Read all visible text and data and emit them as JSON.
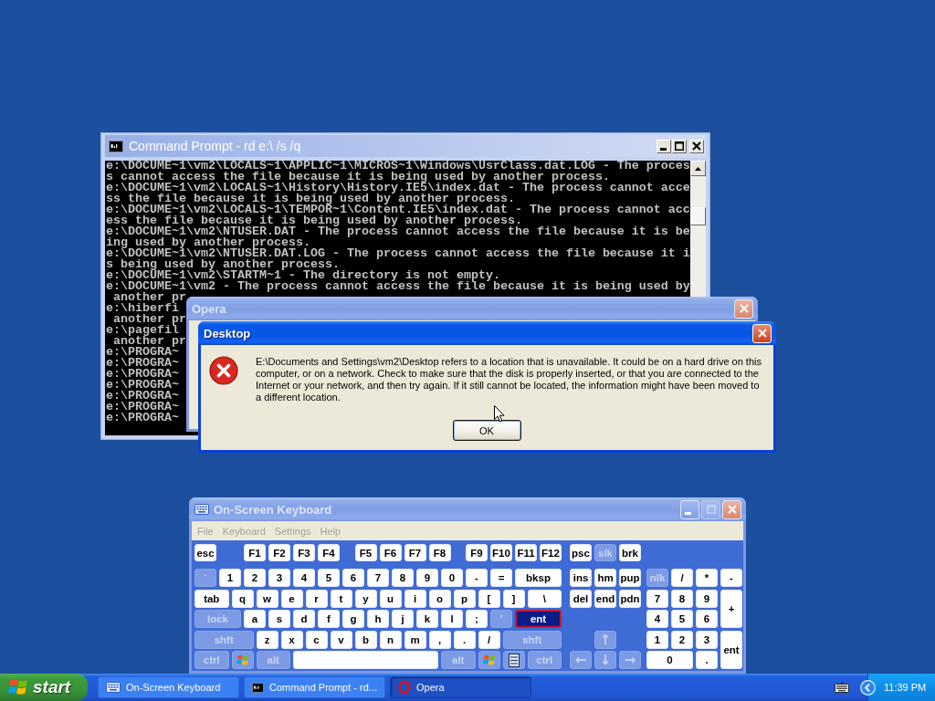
{
  "command_prompt": {
    "title": "Command Prompt - rd e:\\ /s /q",
    "active": false,
    "lines": [
      "e:\\DOCUME~1\\vm2\\LOCALS~1\\APPLIC~1\\MICROS~1\\Windows\\UsrClass.dat.LOG - The proces",
      "s cannot access the file because it is being used by another process.",
      "e:\\DOCUME~1\\vm2\\LOCALS~1\\History\\History.IE5\\index.dat - The process cannot acce",
      "ss the file because it is being used by another process.",
      "e:\\DOCUME~1\\vm2\\LOCALS~1\\TEMPOR~1\\Content.IE5\\index.dat - The process cannot acc",
      "ess the file because it is being used by another process.",
      "e:\\DOCUME~1\\vm2\\NTUSER.DAT - The process cannot access the file because it is be",
      "ing used by another process.",
      "e:\\DOCUME~1\\vm2\\NTUSER.DAT.LOG - The process cannot access the file because it i",
      "s being used by another process.",
      "e:\\DOCUME~1\\vm2\\STARTM~1 - The directory is not empty.",
      "e:\\DOCUME~1\\vm2 - The process cannot access the file because it is being used by",
      " another pr",
      "e:\\hiberfi",
      " another pr",
      "e:\\pagefil",
      " another pr",
      "e:\\PROGRA~",
      "e:\\PROGRA~",
      "e:\\PROGRA~",
      "e:\\PROGRA~",
      "e:\\PROGRA~",
      "e:\\PROGRA~",
      "e:\\PROGRA~"
    ]
  },
  "opera_window": {
    "title": "Opera",
    "active": false
  },
  "error_dialog": {
    "title": "Desktop",
    "active": true,
    "message": "E:\\Documents and Settings\\vm2\\Desktop refers to a location that is unavailable. It could be on a hard drive on this computer, or on a network. Check to make sure that the disk is properly inserted, or that you are connected to the Internet or your network, and then try again. If it still cannot be located, the information might have been moved to a different location.",
    "button": "OK"
  },
  "keyboard": {
    "title": "On-Screen Keyboard",
    "active": false,
    "maximize_disabled": true,
    "menu": [
      {
        "label": "File",
        "disabled": true
      },
      {
        "label": "Keyboard",
        "disabled": true
      },
      {
        "label": "Settings",
        "disabled": true
      },
      {
        "label": "Help",
        "disabled": true
      }
    ],
    "main_rows": [
      [
        {
          "kind": "text",
          "label": "esc",
          "dim": false,
          "highlighted": false
        },
        {
          "kind": "text",
          "label": "F1",
          "dim": false,
          "highlighted": false
        },
        {
          "kind": "text",
          "label": "F2",
          "dim": false,
          "highlighted": false
        },
        {
          "kind": "text",
          "label": "F3",
          "dim": false,
          "highlighted": false
        },
        {
          "kind": "text",
          "label": "F4",
          "dim": false,
          "highlighted": false
        },
        {
          "kind": "text",
          "label": "F5",
          "dim": false,
          "highlighted": false
        },
        {
          "kind": "text",
          "label": "F6",
          "dim": false,
          "highlighted": false
        },
        {
          "kind": "text",
          "label": "F7",
          "dim": false,
          "highlighted": false
        },
        {
          "kind": "text",
          "label": "F8",
          "dim": false,
          "highlighted": false
        },
        {
          "kind": "text",
          "label": "F9",
          "dim": false,
          "highlighted": false
        },
        {
          "kind": "text",
          "label": "F10",
          "dim": false,
          "highlighted": false
        },
        {
          "kind": "text",
          "label": "F11",
          "dim": false,
          "highlighted": false
        },
        {
          "kind": "text",
          "label": "F12",
          "dim": false,
          "highlighted": false
        }
      ],
      [
        {
          "kind": "text",
          "label": "`",
          "dim": true,
          "highlighted": false
        },
        {
          "kind": "text",
          "label": "1",
          "dim": false,
          "highlighted": false
        },
        {
          "kind": "text",
          "label": "2",
          "dim": false,
          "highlighted": false
        },
        {
          "kind": "text",
          "label": "3",
          "dim": false,
          "highlighted": false
        },
        {
          "kind": "text",
          "label": "4",
          "dim": false,
          "highlighted": false
        },
        {
          "kind": "text",
          "label": "5",
          "dim": false,
          "highlighted": false
        },
        {
          "kind": "text",
          "label": "6",
          "dim": false,
          "highlighted": false
        },
        {
          "kind": "text",
          "label": "7",
          "dim": false,
          "highlighted": false
        },
        {
          "kind": "text",
          "label": "8",
          "dim": false,
          "highlighted": false
        },
        {
          "kind": "text",
          "label": "9",
          "dim": false,
          "highlighted": false
        },
        {
          "kind": "text",
          "label": "0",
          "dim": false,
          "highlighted": false
        },
        {
          "kind": "text",
          "label": "-",
          "dim": false,
          "highlighted": false
        },
        {
          "kind": "text",
          "label": "=",
          "dim": false,
          "highlighted": false
        },
        {
          "kind": "text",
          "label": "bksp",
          "dim": false,
          "highlighted": false
        }
      ],
      [
        {
          "kind": "text",
          "label": "tab",
          "dim": false,
          "highlighted": false
        },
        {
          "kind": "text",
          "label": "q",
          "dim": false,
          "highlighted": false
        },
        {
          "kind": "text",
          "label": "w",
          "dim": false,
          "highlighted": false
        },
        {
          "kind": "text",
          "label": "e",
          "dim": false,
          "highlighted": false
        },
        {
          "kind": "text",
          "label": "r",
          "dim": false,
          "highlighted": false
        },
        {
          "kind": "text",
          "label": "t",
          "dim": false,
          "highlighted": false
        },
        {
          "kind": "text",
          "label": "y",
          "dim": false,
          "highlighted": false
        },
        {
          "kind": "text",
          "label": "u",
          "dim": false,
          "highlighted": false
        },
        {
          "kind": "text",
          "label": "i",
          "dim": false,
          "highlighted": false
        },
        {
          "kind": "text",
          "label": "o",
          "dim": false,
          "highlighted": false
        },
        {
          "kind": "text",
          "label": "p",
          "dim": false,
          "highlighted": false
        },
        {
          "kind": "text",
          "label": "[",
          "dim": false,
          "highlighted": false
        },
        {
          "kind": "text",
          "label": "]",
          "dim": false,
          "highlighted": false
        },
        {
          "kind": "text",
          "label": "\\",
          "dim": false,
          "highlighted": false
        }
      ],
      [
        {
          "kind": "text",
          "label": "lock",
          "dim": true,
          "highlighted": false
        },
        {
          "kind": "text",
          "label": "a",
          "dim": false,
          "highlighted": false
        },
        {
          "kind": "text",
          "label": "s",
          "dim": false,
          "highlighted": false
        },
        {
          "kind": "text",
          "label": "d",
          "dim": false,
          "highlighted": false
        },
        {
          "kind": "text",
          "label": "f",
          "dim": false,
          "highlighted": false
        },
        {
          "kind": "text",
          "label": "g",
          "dim": false,
          "highlighted": false
        },
        {
          "kind": "text",
          "label": "h",
          "dim": false,
          "highlighted": false
        },
        {
          "kind": "text",
          "label": "j",
          "dim": false,
          "highlighted": false
        },
        {
          "kind": "text",
          "label": "k",
          "dim": false,
          "highlighted": false
        },
        {
          "kind": "text",
          "label": "l",
          "dim": false,
          "highlighted": false
        },
        {
          "kind": "text",
          "label": ";",
          "dim": false,
          "highlighted": false
        },
        {
          "kind": "text",
          "label": "'",
          "dim": true,
          "highlighted": false
        },
        {
          "kind": "text",
          "label": "ent",
          "dim": false,
          "highlighted": true
        }
      ],
      [
        {
          "kind": "text",
          "label": "shft",
          "dim": true,
          "highlighted": false
        },
        {
          "kind": "text",
          "label": "z",
          "dim": false,
          "highlighted": false
        },
        {
          "kind": "text",
          "label": "x",
          "dim": false,
          "highlighted": false
        },
        {
          "kind": "text",
          "label": "c",
          "dim": false,
          "highlighted": false
        },
        {
          "kind": "text",
          "label": "v",
          "dim": false,
          "highlighted": false
        },
        {
          "kind": "text",
          "label": "b",
          "dim": false,
          "highlighted": false
        },
        {
          "kind": "text",
          "label": "n",
          "dim": false,
          "highlighted": false
        },
        {
          "kind": "text",
          "label": "m",
          "dim": false,
          "highlighted": false
        },
        {
          "kind": "text",
          "label": ",",
          "dim": false,
          "highlighted": false
        },
        {
          "kind": "text",
          "label": ".",
          "dim": false,
          "highlighted": false
        },
        {
          "kind": "text",
          "label": "/",
          "dim": false,
          "highlighted": false
        },
        {
          "kind": "text",
          "label": "shft",
          "dim": true,
          "highlighted": false
        }
      ],
      [
        {
          "kind": "text",
          "label": "ctrl",
          "dim": true,
          "highlighted": false
        },
        {
          "kind": "flag",
          "dim": true,
          "highlighted": false
        },
        {
          "kind": "text",
          "label": "alt",
          "dim": true,
          "highlighted": false
        },
        {
          "kind": "space",
          "dim": false,
          "highlighted": false
        },
        {
          "kind": "text",
          "label": "alt",
          "dim": true,
          "highlighted": false
        },
        {
          "kind": "flag",
          "dim": true,
          "highlighted": false
        },
        {
          "kind": "menu",
          "dim": true,
          "highlighted": false
        },
        {
          "kind": "text",
          "label": "ctrl",
          "dim": true,
          "highlighted": false
        }
      ]
    ],
    "nav_keys": [
      {
        "kind": "text",
        "label": "psc",
        "dim": false,
        "highlighted": false
      },
      {
        "kind": "text",
        "label": "slk",
        "dim": true,
        "highlighted": false
      },
      {
        "kind": "text",
        "label": "brk",
        "dim": false,
        "highlighted": false
      },
      {
        "kind": "text",
        "label": "ins",
        "dim": false,
        "highlighted": false
      },
      {
        "kind": "text",
        "label": "hm",
        "dim": false,
        "highlighted": false
      },
      {
        "kind": "text",
        "label": "pup",
        "dim": false,
        "highlighted": false
      },
      {
        "kind": "text",
        "label": "del",
        "dim": false,
        "highlighted": false
      },
      {
        "kind": "text",
        "label": "end",
        "dim": false,
        "highlighted": false
      },
      {
        "kind": "text",
        "label": "pdn",
        "dim": false,
        "highlighted": false
      },
      {
        "kind": "arrow",
        "label": "↑",
        "dim": true,
        "highlighted": false
      },
      {
        "kind": "arrow",
        "label": "←",
        "dim": true,
        "highlighted": false
      },
      {
        "kind": "arrow",
        "label": "↓",
        "dim": true,
        "highlighted": false
      },
      {
        "kind": "arrow",
        "label": "→",
        "dim": true,
        "highlighted": false
      }
    ],
    "numpad_keys": [
      {
        "kind": "text",
        "label": "nlk",
        "dim": true,
        "highlighted": false
      },
      {
        "kind": "text",
        "label": "/",
        "dim": false,
        "highlighted": false
      },
      {
        "kind": "text",
        "label": "*",
        "dim": false,
        "highlighted": false
      },
      {
        "kind": "text",
        "label": "-",
        "dim": false,
        "highlighted": false
      },
      {
        "kind": "text",
        "label": "7",
        "dim": false,
        "highlighted": false
      },
      {
        "kind": "text",
        "label": "8",
        "dim": false,
        "highlighted": false
      },
      {
        "kind": "text",
        "label": "9",
        "dim": false,
        "highlighted": false
      },
      {
        "kind": "text",
        "label": "+",
        "dim": false,
        "highlighted": false
      },
      {
        "kind": "text",
        "label": "4",
        "dim": false,
        "highlighted": false
      },
      {
        "kind": "text",
        "label": "5",
        "dim": false,
        "highlighted": false
      },
      {
        "kind": "text",
        "label": "6",
        "dim": false,
        "highlighted": false
      },
      {
        "kind": "text",
        "label": "1",
        "dim": false,
        "highlighted": false
      },
      {
        "kind": "text",
        "label": "2",
        "dim": false,
        "highlighted": false
      },
      {
        "kind": "text",
        "label": "3",
        "dim": false,
        "highlighted": false
      },
      {
        "kind": "text",
        "label": "ent",
        "dim": false,
        "highlighted": false
      },
      {
        "kind": "text",
        "label": "0",
        "dim": false,
        "highlighted": false
      },
      {
        "kind": "text",
        "label": ".",
        "dim": false,
        "highlighted": false
      }
    ]
  },
  "taskbar": {
    "start": "start",
    "tasks": [
      {
        "kind": "keyboard",
        "label": "On-Screen Keyboard",
        "selected": false
      },
      {
        "kind": "console",
        "label": "Command Prompt - rd...",
        "selected": false
      },
      {
        "kind": "ring",
        "label": "Opera",
        "selected": true
      }
    ],
    "clock": "11:39 PM"
  }
}
